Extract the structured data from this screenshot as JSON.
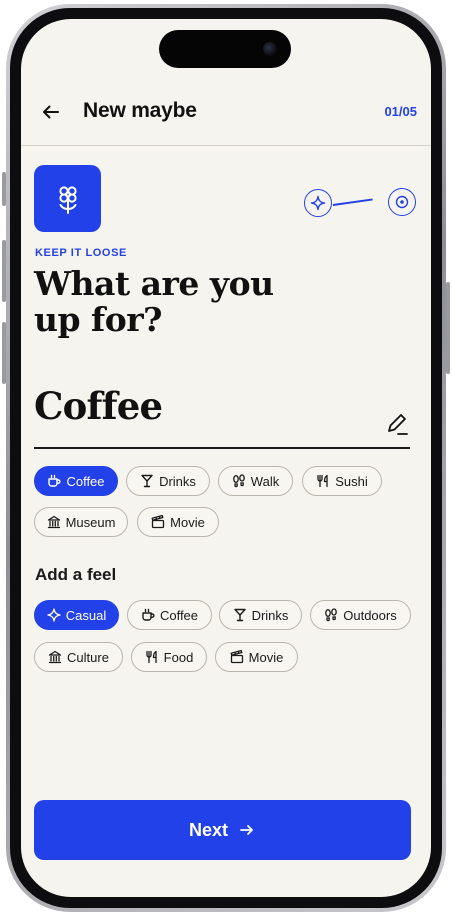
{
  "header": {
    "back_icon": "arrow-left-icon",
    "title": "New maybe",
    "step": "01/05"
  },
  "hero": {
    "logo_icon": "flower-icon",
    "progress_icons": [
      "sparkle-icon",
      "target-icon"
    ]
  },
  "prompt": {
    "eyebrow": "KEEP IT LOOSE",
    "line1": "What are you",
    "line2": "up for?"
  },
  "answer": {
    "value": "Coffee",
    "edit_icon": "pencil-icon"
  },
  "activities": [
    {
      "label": "Coffee",
      "icon": "cup-icon",
      "selected": true
    },
    {
      "label": "Drinks",
      "icon": "cocktail-icon",
      "selected": false
    },
    {
      "label": "Walk",
      "icon": "footprints-icon",
      "selected": false
    },
    {
      "label": "Sushi",
      "icon": "fork-knife-icon",
      "selected": false
    },
    {
      "label": "Museum",
      "icon": "museum-icon",
      "selected": false
    },
    {
      "label": "Movie",
      "icon": "clapperboard-icon",
      "selected": false
    }
  ],
  "feel": {
    "title": "Add a feel",
    "options": [
      {
        "label": "Casual",
        "icon": "sparkle-icon",
        "selected": true
      },
      {
        "label": "Coffee",
        "icon": "cup-icon",
        "selected": false
      },
      {
        "label": "Drinks",
        "icon": "cocktail-icon",
        "selected": false
      },
      {
        "label": "Outdoors",
        "icon": "footprints-icon",
        "selected": false
      },
      {
        "label": "Culture",
        "icon": "museum-icon",
        "selected": false
      },
      {
        "label": "Food",
        "icon": "fork-knife-icon",
        "selected": false
      },
      {
        "label": "Movie",
        "icon": "clapperboard-icon",
        "selected": false
      }
    ]
  },
  "cta": {
    "label": "Next",
    "icon": "arrow-right-icon"
  },
  "colors": {
    "accent": "#2341e8",
    "background": "#f6f4ee",
    "text": "#111111",
    "chip_border": "#b9b6ad"
  }
}
